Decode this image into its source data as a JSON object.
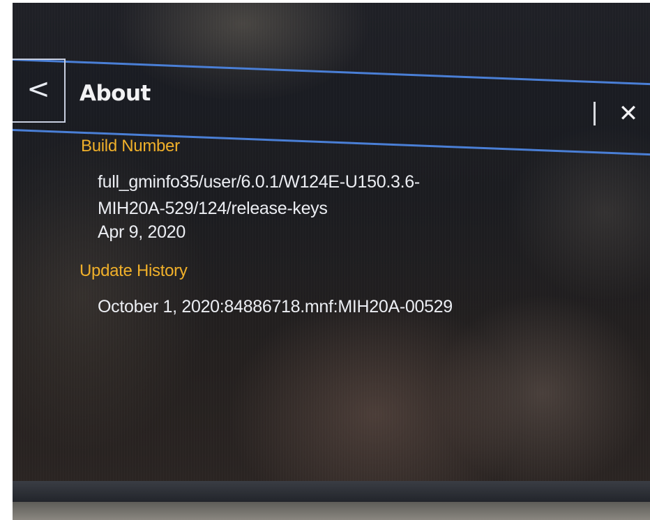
{
  "header": {
    "back_icon": "chevron-left-icon",
    "back_glyph": "<",
    "title": "About",
    "close_icon": "close-icon",
    "close_glyph": "✕",
    "accent_color": "#4a7fd6"
  },
  "build": {
    "heading": "Build Number",
    "line1": "full_gminfo35/user/6.0.1/W124E-U150.3.6-",
    "line2": "MIH20A-529/124/release-keys",
    "date": "Apr 9, 2020"
  },
  "history": {
    "heading": "Update History",
    "entry": "October 1, 2020:84886718.mnf:MIH20A-00529"
  },
  "colors": {
    "heading": "#f0b02a",
    "text": "#eceef3",
    "background": "#1f2026"
  }
}
